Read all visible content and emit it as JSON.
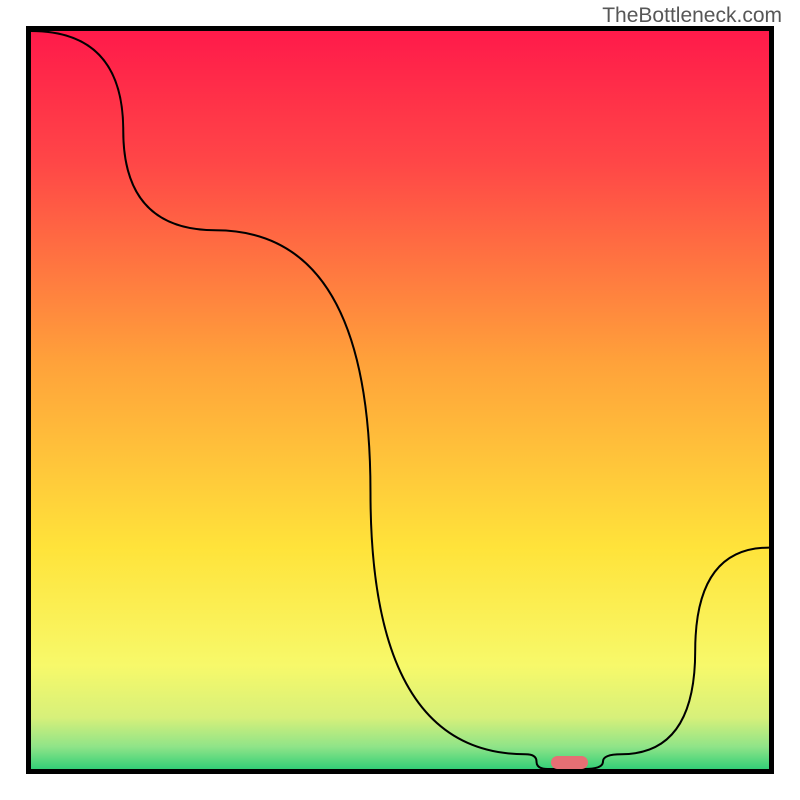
{
  "watermark": "TheBottleneck.com",
  "chart_data": {
    "type": "line",
    "title": "",
    "xlabel": "",
    "ylabel": "",
    "xlim": [
      0,
      100
    ],
    "ylim": [
      0,
      100
    ],
    "x": [
      0,
      25,
      67,
      70,
      75,
      80,
      100
    ],
    "values": [
      100,
      73,
      2,
      0,
      0,
      2,
      30
    ],
    "annotations": [
      {
        "type": "marker",
        "x": 73,
        "y": 0,
        "width_pct": 5,
        "height_pct": 1.8,
        "color": "#e66f74",
        "shape": "pill"
      }
    ],
    "background_gradient_stops": [
      {
        "pct": 0,
        "color": "#ff1a4a"
      },
      {
        "pct": 18,
        "color": "#ff4747"
      },
      {
        "pct": 45,
        "color": "#ffa23a"
      },
      {
        "pct": 70,
        "color": "#ffe33a"
      },
      {
        "pct": 86,
        "color": "#f7f96a"
      },
      {
        "pct": 93,
        "color": "#d7f07a"
      },
      {
        "pct": 97,
        "color": "#8fe488"
      },
      {
        "pct": 100,
        "color": "#33cf77"
      }
    ]
  }
}
